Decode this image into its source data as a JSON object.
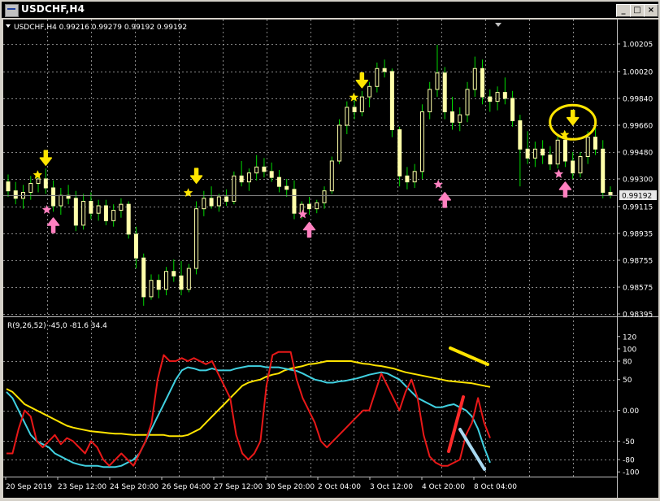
{
  "window": {
    "title": "USDCHF,H4",
    "buttons": {
      "minimize": "_",
      "maximize": "□",
      "close": "×"
    }
  },
  "main_chart": {
    "info": "USDCHF,H4  0.99216 0.99279 0.99192 0.99192",
    "current_price": "0.99192",
    "price_levels": [
      "1.00205",
      "1.00020",
      "0.99840",
      "0.99660",
      "0.99480",
      "0.99300",
      "0.99115",
      "0.98935",
      "0.98755",
      "0.98575",
      "0.98395"
    ]
  },
  "indicator": {
    "label": "R(9,26,52) -45,0 -81.6 34.4",
    "levels": [
      "120",
      "100",
      "80",
      "50",
      "0.00",
      "-50",
      "-80",
      "-100"
    ]
  },
  "time_axis": [
    "20 Sep 2019",
    "23 Sep 12:00",
    "24 Sep 20:00",
    "26 Sep 04:00",
    "27 Sep 12:00",
    "30 Sep 20:00",
    "2 Oct 04:00",
    "3 Oct 12:00",
    "4 Oct 20:00",
    "8 Oct 04:00"
  ],
  "colors": {
    "background": "#000000",
    "candle": "#ffffaa",
    "wick": "#00d800",
    "grid": "#c0c0c0",
    "sell_arrow": "#ffe500",
    "buy_arrow": "#ff80c0",
    "line_fast": "#e81818",
    "line_mid": "#40d0e0",
    "line_slow": "#ffe400"
  },
  "chart_data": {
    "type": "candlestick",
    "symbol": "USDCHF",
    "timeframe": "H4",
    "ylim": [
      0.98395,
      1.00205
    ],
    "candles": [
      [
        0.9928,
        0.9933,
        0.9918,
        0.9922
      ],
      [
        0.9922,
        0.9928,
        0.9913,
        0.9917
      ],
      [
        0.9917,
        0.9926,
        0.991,
        0.9921
      ],
      [
        0.9921,
        0.9932,
        0.9916,
        0.9927
      ],
      [
        0.9927,
        0.9935,
        0.9921,
        0.993
      ],
      [
        0.993,
        0.9937,
        0.992,
        0.9924
      ],
      [
        0.9924,
        0.9929,
        0.9908,
        0.9912
      ],
      [
        0.9912,
        0.9924,
        0.9906,
        0.9919
      ],
      [
        0.9919,
        0.9926,
        0.9913,
        0.9917
      ],
      [
        0.9917,
        0.9922,
        0.9895,
        0.9899
      ],
      [
        0.9899,
        0.992,
        0.9896,
        0.9915
      ],
      [
        0.9915,
        0.9921,
        0.9903,
        0.9907
      ],
      [
        0.9907,
        0.9916,
        0.9902,
        0.9912
      ],
      [
        0.9912,
        0.9916,
        0.9899,
        0.9902
      ],
      [
        0.9902,
        0.9913,
        0.9898,
        0.9909
      ],
      [
        0.9909,
        0.9917,
        0.9904,
        0.9913
      ],
      [
        0.9913,
        0.9915,
        0.989,
        0.9893
      ],
      [
        0.9893,
        0.9898,
        0.987,
        0.9877
      ],
      [
        0.9877,
        0.988,
        0.9845,
        0.9851
      ],
      [
        0.9851,
        0.9866,
        0.9849,
        0.9862
      ],
      [
        0.9862,
        0.9866,
        0.985,
        0.9856
      ],
      [
        0.9856,
        0.9871,
        0.9852,
        0.9868
      ],
      [
        0.9868,
        0.9876,
        0.9861,
        0.9865
      ],
      [
        0.9865,
        0.9875,
        0.9852,
        0.9856
      ],
      [
        0.9856,
        0.9873,
        0.9854,
        0.987
      ],
      [
        0.987,
        0.9915,
        0.9866,
        0.991
      ],
      [
        0.991,
        0.9922,
        0.9905,
        0.9917
      ],
      [
        0.9917,
        0.9925,
        0.991,
        0.9912
      ],
      [
        0.9912,
        0.992,
        0.9908,
        0.9918
      ],
      [
        0.9918,
        0.9923,
        0.9912,
        0.9915
      ],
      [
        0.9915,
        0.9935,
        0.9913,
        0.9932
      ],
      [
        0.9932,
        0.9942,
        0.9925,
        0.9928
      ],
      [
        0.9928,
        0.9937,
        0.9922,
        0.9934
      ],
      [
        0.9934,
        0.9946,
        0.9929,
        0.9938
      ],
      [
        0.9938,
        0.9944,
        0.9931,
        0.9935
      ],
      [
        0.9935,
        0.9941,
        0.9928,
        0.9931
      ],
      [
        0.9931,
        0.9936,
        0.9921,
        0.9925
      ],
      [
        0.9925,
        0.993,
        0.9918,
        0.9923
      ],
      [
        0.9923,
        0.9929,
        0.9903,
        0.9907
      ],
      [
        0.9907,
        0.9915,
        0.9903,
        0.9913
      ],
      [
        0.9913,
        0.9918,
        0.9906,
        0.991
      ],
      [
        0.991,
        0.9916,
        0.9907,
        0.9914
      ],
      [
        0.9914,
        0.9925,
        0.991,
        0.9922
      ],
      [
        0.9922,
        0.9945,
        0.992,
        0.9942
      ],
      [
        0.9942,
        0.997,
        0.994,
        0.9966
      ],
      [
        0.9966,
        0.9982,
        0.996,
        0.9978
      ],
      [
        0.9978,
        0.9984,
        0.997,
        0.9975
      ],
      [
        0.9975,
        0.9989,
        0.9972,
        0.9985
      ],
      [
        0.9985,
        0.9995,
        0.9978,
        0.9992
      ],
      [
        0.9992,
        1.0008,
        0.9988,
        1.0004
      ],
      [
        1.0004,
        1.001,
        0.9998,
        1.0002
      ],
      [
        1.0002,
        1.0004,
        0.9958,
        0.9963
      ],
      [
        0.9963,
        0.9965,
        0.9925,
        0.9932
      ],
      [
        0.9932,
        0.9938,
        0.9923,
        0.9928
      ],
      [
        0.9928,
        0.994,
        0.9924,
        0.9935
      ],
      [
        0.9935,
        0.998,
        0.993,
        0.9975
      ],
      [
        0.9975,
        0.9995,
        0.997,
        0.999
      ],
      [
        0.999,
        1.002,
        0.9985,
        1.0001
      ],
      [
        1.0001,
        1.0005,
        0.997,
        0.9975
      ],
      [
        0.9975,
        0.9985,
        0.9963,
        0.9968
      ],
      [
        0.9968,
        0.9978,
        0.9962,
        0.9973
      ],
      [
        0.9973,
        0.9995,
        0.9968,
        0.999
      ],
      [
        0.999,
        1.0012,
        0.9985,
        1.0004
      ],
      [
        1.0004,
        1.001,
        0.998,
        0.9985
      ],
      [
        0.9985,
        0.999,
        0.9975,
        0.9982
      ],
      [
        0.9982,
        0.9992,
        0.9976,
        0.9988
      ],
      [
        0.9988,
        0.9998,
        0.998,
        0.9984
      ],
      [
        0.9984,
        0.9989,
        0.9965,
        0.9969
      ],
      [
        0.9969,
        0.9973,
        0.9925,
        0.995
      ],
      [
        0.995,
        0.9962,
        0.994,
        0.9944
      ],
      [
        0.9944,
        0.9955,
        0.9938,
        0.995
      ],
      [
        0.995,
        0.9956,
        0.994,
        0.9946
      ],
      [
        0.9946,
        0.9952,
        0.9936,
        0.994
      ],
      [
        0.994,
        0.996,
        0.9937,
        0.9956
      ],
      [
        0.9956,
        0.9962,
        0.9938,
        0.9942
      ],
      [
        0.9942,
        0.9948,
        0.993,
        0.9934
      ],
      [
        0.9934,
        0.9948,
        0.9931,
        0.9945
      ],
      [
        0.9945,
        0.9962,
        0.994,
        0.9958
      ],
      [
        0.9958,
        0.9964,
        0.9946,
        0.995
      ],
      [
        0.995,
        0.9956,
        0.9917,
        0.9921
      ],
      [
        0.9921,
        0.9925,
        0.9917,
        0.9919
      ]
    ],
    "sell_signals": [
      {
        "index": 5,
        "price": 0.9937
      },
      {
        "index": 25,
        "price": 0.9925
      },
      {
        "index": 47,
        "price": 0.9989
      },
      {
        "index": 75,
        "price": 0.9964
      }
    ],
    "buy_signals": [
      {
        "index": 6,
        "price": 0.9906
      },
      {
        "index": 40,
        "price": 0.9903
      },
      {
        "index": 58,
        "price": 0.9923
      },
      {
        "index": 74,
        "price": 0.993
      }
    ],
    "highlight_index": 75,
    "indicator_series": [
      {
        "color": "#e81818",
        "values": [
          -70,
          -70,
          -30,
          0,
          -10,
          -50,
          -60,
          -50,
          -40,
          -55,
          -45,
          -50,
          -60,
          -70,
          -50,
          -60,
          -80,
          -90,
          -80,
          -70,
          -80,
          -90,
          -70,
          -50,
          -20,
          50,
          90,
          80,
          80,
          85,
          80,
          85,
          80,
          75,
          80,
          60,
          40,
          20,
          -40,
          -70,
          -80,
          -70,
          -50,
          40,
          90,
          95,
          95,
          95,
          50,
          20,
          0,
          -20,
          -50,
          -60,
          -50,
          -40,
          -30,
          -20,
          -10,
          0,
          0,
          30,
          60,
          40,
          20,
          0,
          30,
          50,
          20,
          -40,
          -75,
          -85,
          -90,
          -90,
          -85,
          -80,
          -40,
          -20,
          20,
          -20,
          -45
        ]
      },
      {
        "color": "#40d0e0",
        "values": [
          30,
          20,
          0,
          -20,
          -40,
          -50,
          -55,
          -60,
          -70,
          -75,
          -80,
          -85,
          -88,
          -90,
          -90,
          -90,
          -92,
          -92,
          -92,
          -90,
          -85,
          -80,
          -70,
          -50,
          -30,
          -10,
          10,
          30,
          50,
          65,
          70,
          68,
          65,
          65,
          68,
          65,
          65,
          65,
          68,
          70,
          72,
          72,
          72,
          70,
          70,
          70,
          68,
          66,
          64,
          60,
          55,
          50,
          48,
          45,
          45,
          47,
          48,
          50,
          52,
          55,
          58,
          60,
          62,
          60,
          55,
          50,
          40,
          30,
          20,
          15,
          10,
          5,
          5,
          8,
          10,
          5,
          0,
          -10,
          -30,
          -60,
          -85
        ]
      },
      {
        "color": "#ffe400",
        "values": [
          35,
          30,
          20,
          10,
          5,
          0,
          -5,
          -10,
          -15,
          -20,
          -25,
          -28,
          -30,
          -32,
          -34,
          -35,
          -36,
          -37,
          -38,
          -38,
          -39,
          -40,
          -40,
          -40,
          -40,
          -40,
          -40,
          -42,
          -42,
          -42,
          -40,
          -35,
          -30,
          -20,
          -10,
          0,
          10,
          20,
          30,
          40,
          45,
          48,
          50,
          55,
          58,
          60,
          65,
          68,
          70,
          72,
          75,
          76,
          78,
          80,
          80,
          80,
          80,
          80,
          78,
          76,
          75,
          73,
          72,
          70,
          68,
          65,
          62,
          60,
          58,
          56,
          54,
          52,
          50,
          48,
          47,
          46,
          45,
          44,
          42,
          40,
          38
        ]
      }
    ],
    "indicator_ylim": [
      -105,
      125
    ]
  }
}
